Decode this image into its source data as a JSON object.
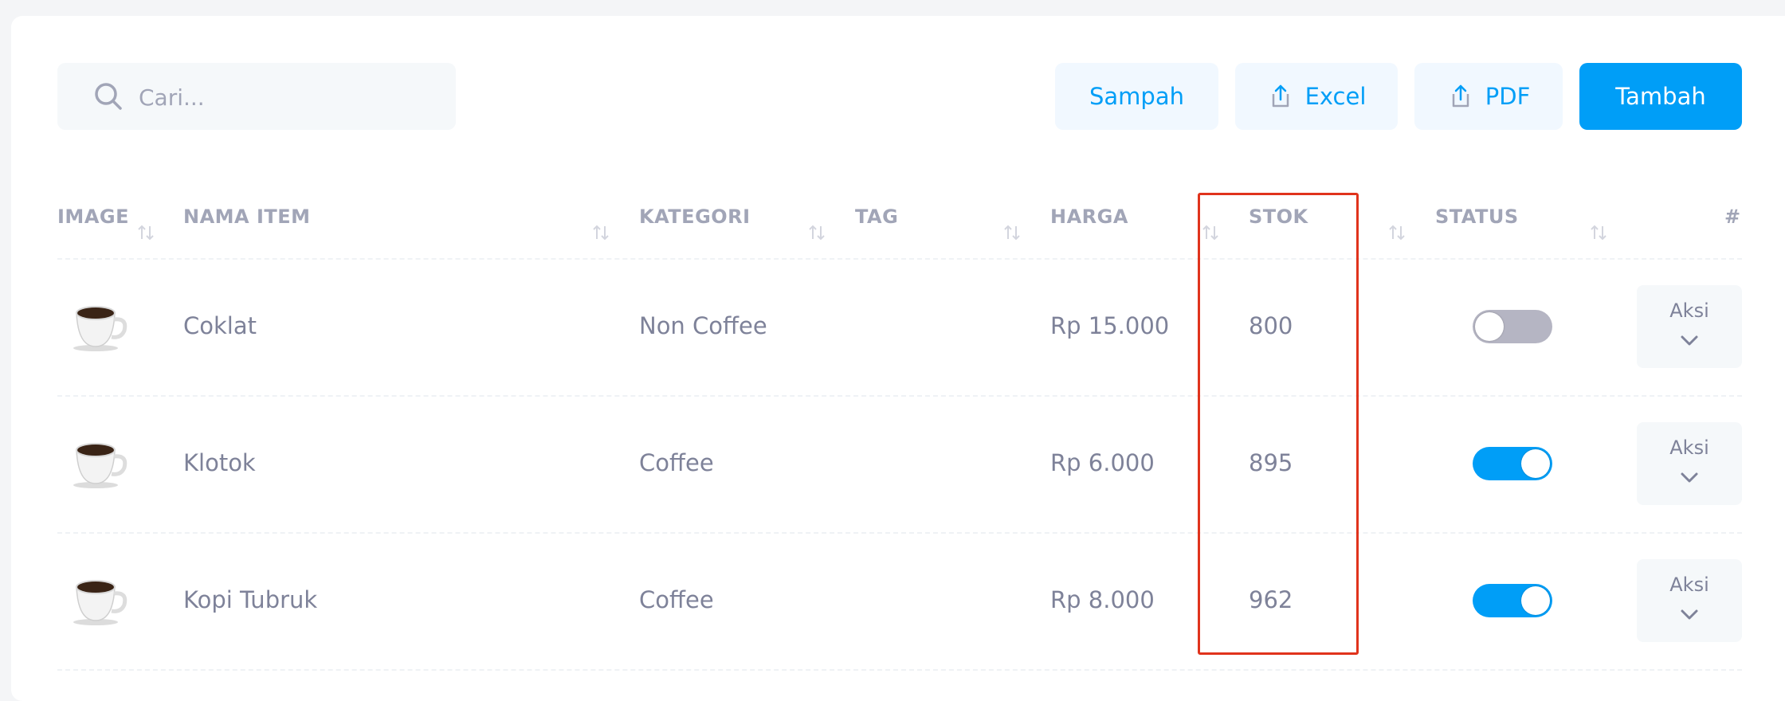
{
  "toolbar": {
    "search_placeholder": "Cari...",
    "trash_label": "Sampah",
    "excel_label": "Excel",
    "pdf_label": "PDF",
    "add_label": "Tambah"
  },
  "table": {
    "headers": {
      "image": "IMAGE",
      "name": "NAMA ITEM",
      "category": "KATEGORI",
      "tag": "TAG",
      "price": "HARGA",
      "stock": "STOK",
      "status": "STATUS",
      "actions": "#"
    },
    "rows": [
      {
        "name": "Coklat",
        "category": "Non Coffee",
        "tag": "",
        "price": "Rp 15.000",
        "stock": "800",
        "status_on": false,
        "action_label": "Aksi"
      },
      {
        "name": "Klotok",
        "category": "Coffee",
        "tag": "",
        "price": "Rp 6.000",
        "stock": "895",
        "status_on": true,
        "action_label": "Aksi"
      },
      {
        "name": "Kopi Tubruk",
        "category": "Coffee",
        "tag": "",
        "price": "Rp 8.000",
        "stock": "962",
        "status_on": true,
        "action_label": "Aksi"
      }
    ]
  },
  "colors": {
    "primary": "#009ef7",
    "highlight": "#e0331c",
    "muted_text": "#a1a5b7",
    "body_text": "#7e8299"
  },
  "icons": {
    "search": "search-icon",
    "export": "export-icon",
    "sort": "sort-arrows-icon",
    "product": "coffee-cup-icon",
    "chevron": "chevron-down-icon"
  }
}
